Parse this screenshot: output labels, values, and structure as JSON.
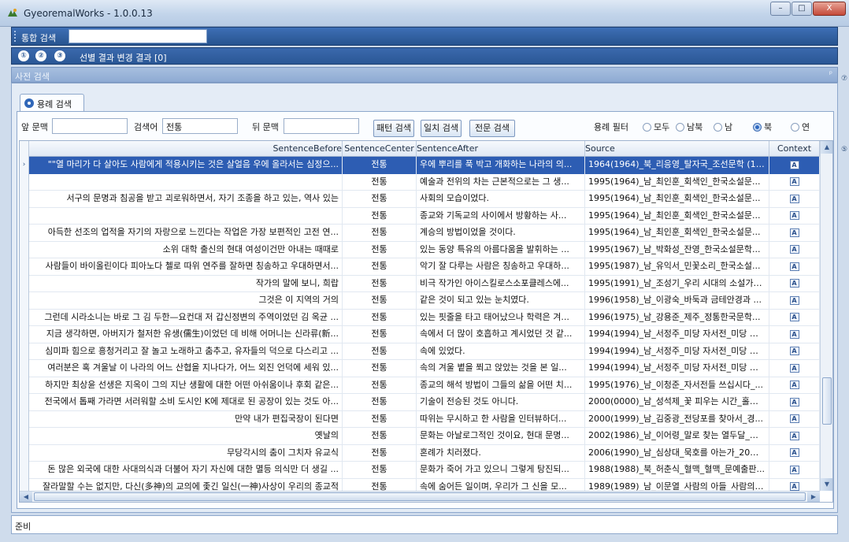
{
  "window": {
    "title": "GyeoremalWorks - 1.0.0.13",
    "buttons": {
      "minimize": "–",
      "maximize": "□",
      "close": "X"
    }
  },
  "integrated_search": {
    "label": "통합 검색",
    "value": ""
  },
  "steps": {
    "items": [
      "①",
      "②",
      "③"
    ],
    "text": "선별 결과 변경 결과 [0]"
  },
  "dictionary_search": {
    "label": "사전 검색",
    "pin": "ᵖ"
  },
  "right_rail": [
    "⑦",
    "⑤"
  ],
  "tabs": [
    {
      "label": "용례 검색",
      "active": true
    }
  ],
  "query": {
    "front_label": "앞 문맥",
    "front_value": "",
    "keyword_label": "검색어",
    "keyword_value": "전통",
    "back_label": "뒤 문맥",
    "back_value": "",
    "buttons": {
      "pattern": "패턴 검색",
      "exact": "일치 검색",
      "full": "전문 검색"
    },
    "filter_label": "용례 필터",
    "filters": [
      {
        "label": "모두",
        "checked": false
      },
      {
        "label": "남북",
        "checked": false
      },
      {
        "label": "남",
        "checked": false
      },
      {
        "label": "북",
        "checked": true
      },
      {
        "label": "연",
        "checked": false
      }
    ]
  },
  "table": {
    "columns": [
      "SentenceBefore",
      "SentenceCenter",
      "SentenceAfter",
      "Source",
      "Context"
    ],
    "context_icon": "A",
    "row_indicator": "›",
    "selected_row": 0,
    "rows": [
      [
        "\"\"열 마리가 다 살아도 사람에게 적용시키는 것은 살얼음 우에 올라서는 심정으...",
        "전통",
        "우에 뿌리를 푹 박고 개화하는 나라의 의...",
        "1964(1964)_북_리응영_탈자국_조선문학 (19..."
      ],
      [
        "",
        "전통",
        "예술과 전위의 차는 근본적으로는 그 생...",
        "1995(1964)_남_최인훈_회색인_한국소설문..."
      ],
      [
        "서구의 문명과 침공을 받고 괴로워하면서, 자기 조종을 하고 있는, 역사 있는",
        "전통",
        "사회의 모습이었다.",
        "1995(1964)_남_최인훈_회색인_한국소설문..."
      ],
      [
        "",
        "전통",
        "종교와 기독교의 사이에서 방황하는 사...",
        "1995(1964)_남_최인훈_회색인_한국소설문..."
      ],
      [
        "아득한 선조의 업적을 자기의 자랑으로 느낀다는 작업은 가장 보편적인 고전 연...",
        "전통",
        "계승의 방법이었을 것이다.",
        "1995(1964)_남_최인훈_회색인_한국소설문..."
      ],
      [
        "소위 대학 출신의 현대 여성이건만 아내는 때때로",
        "전통",
        "있는 동양 특유의 아름다움을 발휘하는 ...",
        "1995(1967)_남_박화성_잔영_한국소설문학..."
      ],
      [
        "사람들이 바이올린이다 피아노다 첼로 따위 연주를 잘하면 칭송하고 우대하면서...",
        "전통",
        "악기 잘 다루는 사람은 칭송하고 우대하...",
        "1995(1987)_남_유익서_민꽃소리_한국소설..."
      ],
      [
        "작가의 말에 보니, 희랍",
        "전통",
        "비극 작가인 아이스킬로스소포클레스에...",
        "1995(1991)_남_조성기_우리 시대의 소설가_..."
      ],
      [
        "그것은 이 지역의 거의",
        "전통",
        "같은 것이 되고 있는 눈치였다.",
        "1996(1958)_남_이광숙_바둑과 금테안경과 ..."
      ],
      [
        "그런데 시라소니는 바로 그 김 두한—요컨대 저 갑신정변의 주역이었던 김 옥균 ...",
        "전통",
        "있는 핏줄을 타고 태어났으나 학력은 겨...",
        "1996(1975)_남_강용준_제주_정통한국문학..."
      ],
      [
        "지금 생각하면, 아버지가 철저한 유생(儒生)이었던 데 비해 어머니는 신라류(新...",
        "전통",
        "속에서 더 많이 호흡하고 계시었던 것 같...",
        "1994(1994)_남_서정주_미당 자서전_미당 자..."
      ],
      [
        "심미파 힘으로 흥청거리고 잘 놀고 노래하고 춤추고, 유자들의 덕으로 다스리고 ...",
        "전통",
        "속에 있었다.",
        "1994(1994)_남_서정주_미당 자서전_미당 자..."
      ],
      [
        "여러분은 혹 겨울날 이 나라의 어느 산협을 지나다가, 어느 외진 언덕에 세워 있...",
        "전통",
        "속의 겨울 볕을 쬐고 앉았는 것을 본 일...",
        "1994(1994)_남_서정주_미당 자서전_미당 자..."
      ],
      [
        "하지만 최상윤 선생은 지옥이 그의 지난 생활에 대한 어떤 아쉬움이나 후회 같은...",
        "전통",
        "종교의 해석 방법이 그들의 삶을 어떤 치...",
        "1995(1976)_남_이청준_자서전들 쓰십시다_..."
      ],
      [
        "전국에서 톱째 가라면 서러워할 소비 도시인 K에 제대로 된 공장이 있는 것도 아...",
        "전통",
        "기술이 전승된 것도 아니다.",
        "2000(0000)_남_성석제_꽃 피우는 시간_홀림..."
      ],
      [
        "만약 내가 편집국장이 된다면",
        "전통",
        "따위는 무시하고 한 사람을 인터뷰하더...",
        "2000(1999)_남_김중광_전당포를 찾아서_경..."
      ],
      [
        "옛날의",
        "전통",
        "문화는 아날로그적인 것이요, 현대 문명...",
        "2002(1986)_남_이어령_말로 찾는 열두달_말..."
      ],
      [
        "무당각시의 춤이 그치자 유교식",
        "전통",
        "혼례가 치러졌다.",
        "2006(1990)_남_심상대_묵호를 아는가_20세..."
      ],
      [
        "돈 많은 외국에 대한 사대의식과 더불어 자기 자신에 대한 멸등 의식만 더 생길 ...",
        "전통",
        "문화가 죽어 가고 있으니 그렇게 탕진되...",
        "1988(1988)_북_허춘식_혈맥_혈맥_문예출판..."
      ],
      [
        "잘라말할 수는 없지만, 다신(多神)의 교의에 좇긴 일신(一神)사상이 우리의 종교적",
        "전통",
        "속에 숨어든 일이며, 우리가 그 신을 모...",
        "1989(1989)_남_이문열_사람의 아들_사람의 ..."
      ]
    ]
  },
  "scroll": {
    "up": "▲",
    "down": "▼",
    "left": "◀",
    "right": "▶"
  },
  "status": {
    "text": "준비"
  }
}
